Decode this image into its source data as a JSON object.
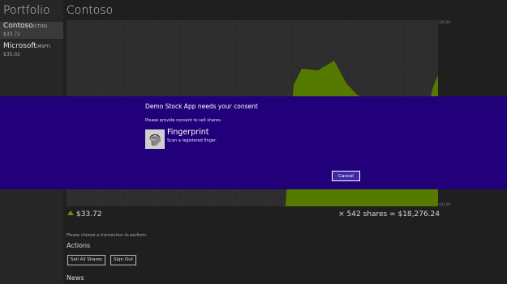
{
  "sidebar": {
    "title": "Portfolio",
    "stocks": [
      {
        "name": "Contoso",
        "ticker": "(CTOS)",
        "price": "$33.72",
        "selected": true
      },
      {
        "name": "Microsoft",
        "ticker": "(MSFT)",
        "price": "$35.02",
        "selected": false
      }
    ]
  },
  "main": {
    "title": "Contoso",
    "axis_top": "$35.00",
    "axis_bottom": "$31.00",
    "current_price": "$33.72",
    "holdings": "× 542 shares = $18,276.24",
    "hint": "Please choose a transaction to perform.",
    "actions_heading": "Actions",
    "actions": [
      {
        "label": "Sell All Shares"
      },
      {
        "label": "Sign Out"
      }
    ],
    "news_heading": "News"
  },
  "dialog": {
    "title": "Demo Stock App needs your consent",
    "message": "Please provide consent to sell shares.",
    "option_name": "Fingerprint",
    "option_desc": "Scan a registered finger.",
    "cancel_label": "Cancel"
  },
  "colors": {
    "chart_fill": "#567a00",
    "dialog_bg": "#22007a",
    "background": "#1f1f1f"
  },
  "icons": {
    "up": "up-arrow-icon",
    "fingerprint": "fingerprint-icon"
  }
}
